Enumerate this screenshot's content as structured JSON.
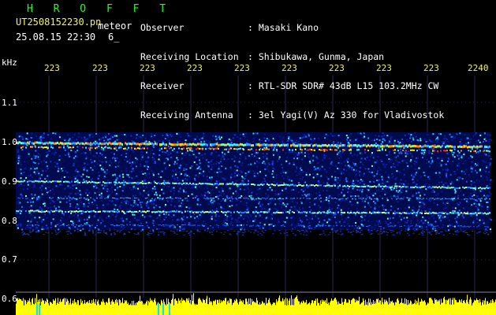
{
  "header": {
    "title": "H R O F F T",
    "filename": "UT2508152230.pn",
    "meteor_label": "meteor",
    "timestamp": "25.08.15 22:30",
    "count": "6_"
  },
  "info": {
    "rows": [
      {
        "label": "Observer",
        "value": ": Masaki Kano"
      },
      {
        "label": "Receiving Location",
        "value": ": Shibukawa, Gunma, Japan"
      },
      {
        "label": "Receiver",
        "value": ": RTL-SDR SDR# 43dB L15 103.2MHz CW"
      },
      {
        "label": "Receiving Antenna",
        "value": ": 3el Yagi(V) Az 330 for Vladivostok"
      }
    ]
  },
  "axes": {
    "unit": "kHz",
    "x_ticks": [
      "223",
      "223",
      "223",
      "223",
      "223",
      "223",
      "223",
      "223",
      "223",
      "2240"
    ],
    "y_ticks": [
      "1.1",
      "1.0",
      "0.9",
      "0.8",
      "0.7",
      "0.6"
    ]
  },
  "colors": {
    "background": "#000000",
    "title": "#22ff22",
    "yellow": "#f2f26a",
    "text": "#ffffff",
    "grid": "#2a2a55",
    "level": "#ffff00",
    "marker": "#00e5ff"
  }
}
